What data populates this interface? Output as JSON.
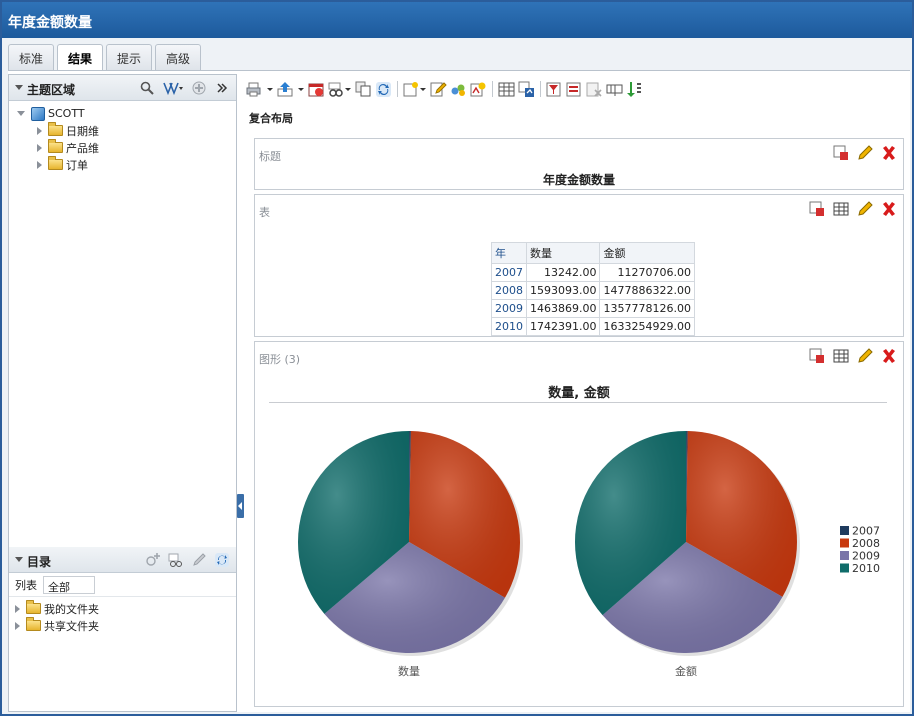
{
  "window": {
    "title": "年度金额数量"
  },
  "tabs": [
    {
      "label": "标准",
      "active": false
    },
    {
      "label": "结果",
      "active": true
    },
    {
      "label": "提示",
      "active": false
    },
    {
      "label": "高级",
      "active": false
    }
  ],
  "subject_area": {
    "title": "主题区域",
    "root": "SCOTT",
    "items": [
      "日期维",
      "产品维",
      "订单"
    ]
  },
  "catalog": {
    "title": "目录",
    "list_label": "列表",
    "list_value": "全部",
    "items": [
      "我的文件夹",
      "共享文件夹"
    ]
  },
  "compound_layout": {
    "label": "复合布局"
  },
  "title_view": {
    "label": "标题",
    "text": "年度金额数量"
  },
  "table_view": {
    "label": "表",
    "columns": [
      "年",
      "数量",
      "金额"
    ],
    "rows": [
      [
        "2007",
        "13242.00",
        "11270706.00"
      ],
      [
        "2008",
        "1593093.00",
        "1477886322.00"
      ],
      [
        "2009",
        "1463869.00",
        "1357778126.00"
      ],
      [
        "2010",
        "1742391.00",
        "1633254929.00"
      ]
    ]
  },
  "graph_view": {
    "label": "图形 (3)"
  },
  "chart_data": {
    "type": "pie",
    "title": "数量, 金额",
    "categories": [
      "2007",
      "2008",
      "2009",
      "2010"
    ],
    "colors": [
      "#1f3b5e",
      "#c8390f",
      "#7a75a8",
      "#0f6c6a"
    ],
    "series": [
      {
        "name": "数量",
        "values": [
          13242.0,
          1593093.0,
          1463869.0,
          1742391.0
        ]
      },
      {
        "name": "金额",
        "values": [
          11270706.0,
          1477886322.0,
          1357778126.0,
          1633254929.0
        ]
      }
    ],
    "legend_position": "right"
  }
}
